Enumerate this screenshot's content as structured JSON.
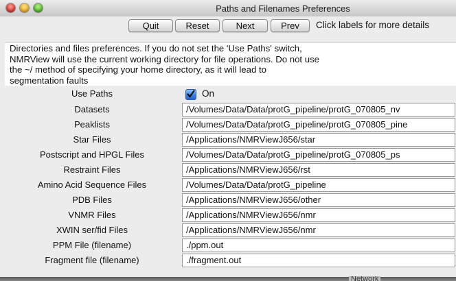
{
  "window": {
    "title": "Paths and Filenames Preferences"
  },
  "toolbar": {
    "quit_label": "Quit",
    "reset_label": "Reset",
    "next_label": "Next",
    "prev_label": "Prev",
    "hint": "Click labels for more details"
  },
  "description": {
    "lines": [
      "Directories and files preferences.  If you do not set the 'Use Paths' switch,",
      "NMRView will use the current working directory for file operations.  Do not use",
      "the ~/ method of specifying your home directory, as it will lead to",
      "segmentation faults"
    ]
  },
  "use_paths": {
    "label": "Use Paths",
    "checked": true,
    "checkbox_label": "On"
  },
  "fields": [
    {
      "label": "Datasets",
      "value": "/Volumes/Data/Data/protG_pipeline/protG_070805_nv"
    },
    {
      "label": "Peaklists",
      "value": "/Volumes/Data/Data/protG_pipeline/protG_070805_pine"
    },
    {
      "label": "Star Files",
      "value": "/Applications/NMRViewJ656/star"
    },
    {
      "label": "Postscript and HPGL Files",
      "value": "/Volumes/Data/Data/protG_pipeline/protG_070805_ps"
    },
    {
      "label": "Restraint Files",
      "value": "/Applications/NMRViewJ656/rst"
    },
    {
      "label": "Amino Acid Sequence Files",
      "value": "/Volumes/Data/Data/protG_pipeline"
    },
    {
      "label": "PDB Files",
      "value": "/Applications/NMRViewJ656/other"
    },
    {
      "label": "VNMR Files",
      "value": "/Applications/NMRViewJ656/nmr"
    },
    {
      "label": "XWIN ser/fid Files",
      "value": "/Applications/NMRViewJ656/nmr"
    },
    {
      "label": "PPM File (filename)",
      "value": "./ppm.out"
    },
    {
      "label": "Fragment file (filename)",
      "value": "./fragment.out"
    }
  ],
  "background_peek": "Network",
  "colors": {
    "checkbox_accent": "#3b82e6"
  }
}
